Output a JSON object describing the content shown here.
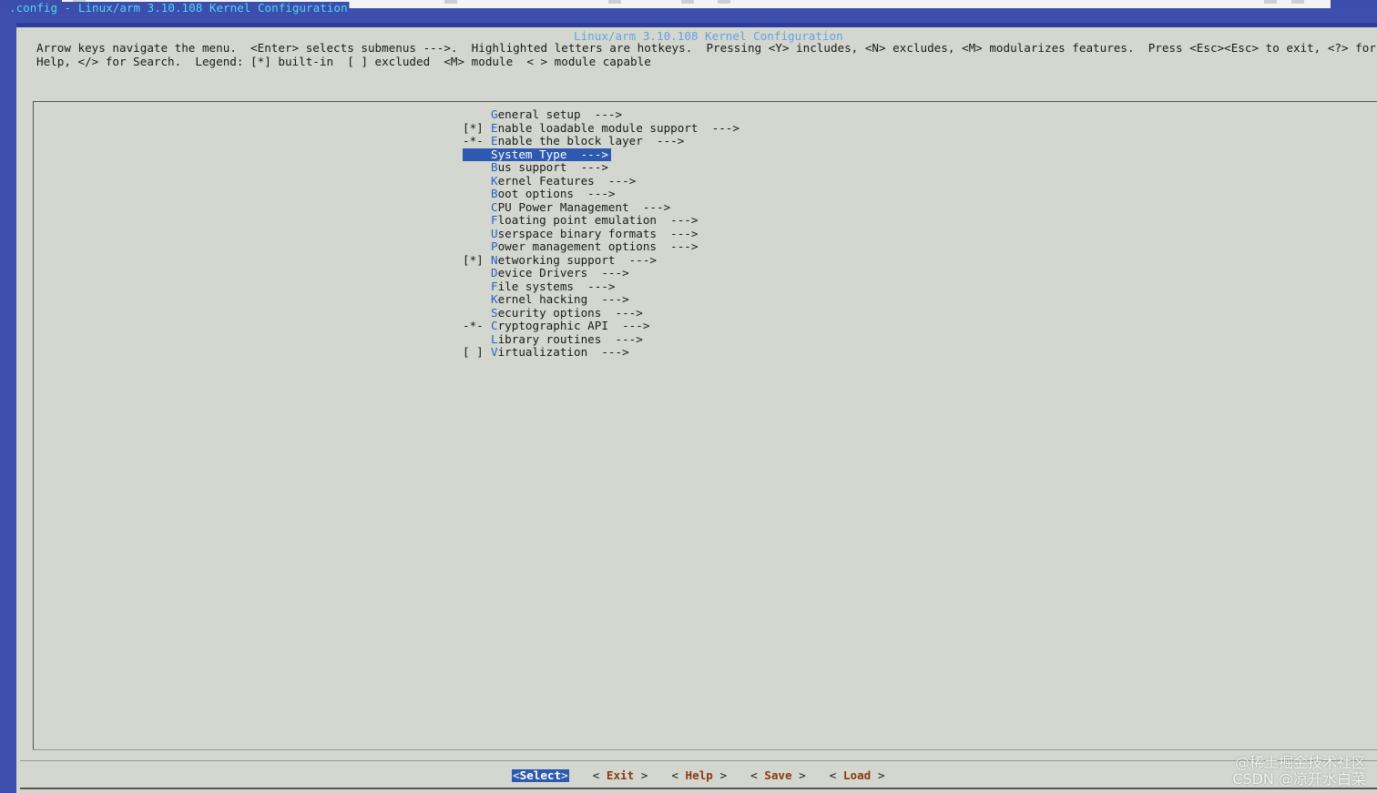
{
  "window": {
    "title": ".config - Linux/arm 3.10.108 Kernel Configuration"
  },
  "dialog": {
    "title": "Linux/arm 3.10.108 Kernel Configuration",
    "help_line1": "Arrow keys navigate the menu.  <Enter> selects submenus --->.  Highlighted letters are hotkeys.  Pressing <Y> includes, <N> excludes, <M> modularizes features.  Press <Esc><Esc> to exit, <?> for",
    "help_line2": "Help, </> for Search.  Legend: [*] built-in  [ ] excluded  <M> module  < > module capable"
  },
  "menu": {
    "selected_index": 3,
    "items": [
      {
        "mark": "   ",
        "hotkey": "G",
        "rest": "eneral setup  --->"
      },
      {
        "mark": "[*]",
        "hotkey": "E",
        "rest": "nable loadable module support  --->"
      },
      {
        "mark": "-*-",
        "hotkey": "E",
        "rest": "nable the block layer  --->"
      },
      {
        "mark": "   ",
        "hotkey": "S",
        "rest": "ystem Type  --->"
      },
      {
        "mark": "   ",
        "hotkey": "B",
        "rest": "us support  --->"
      },
      {
        "mark": "   ",
        "hotkey": "K",
        "rest": "ernel Features  --->"
      },
      {
        "mark": "   ",
        "hotkey": "B",
        "rest": "oot options  --->"
      },
      {
        "mark": "   ",
        "hotkey": "C",
        "rest": "PU Power Management  --->"
      },
      {
        "mark": "   ",
        "hotkey": "F",
        "rest": "loating point emulation  --->"
      },
      {
        "mark": "   ",
        "hotkey": "U",
        "rest": "serspace binary formats  --->"
      },
      {
        "mark": "   ",
        "hotkey": "P",
        "rest": "ower management options  --->"
      },
      {
        "mark": "[*]",
        "hotkey": "N",
        "rest": "etworking support  --->"
      },
      {
        "mark": "   ",
        "hotkey": "D",
        "rest": "evice Drivers  --->"
      },
      {
        "mark": "   ",
        "hotkey": "F",
        "rest": "ile systems  --->"
      },
      {
        "mark": "   ",
        "hotkey": "K",
        "rest": "ernel hacking  --->"
      },
      {
        "mark": "   ",
        "hotkey": "S",
        "rest": "ecurity options  --->"
      },
      {
        "mark": "-*-",
        "hotkey": "C",
        "rest": "ryptographic API  --->"
      },
      {
        "mark": "   ",
        "hotkey": "L",
        "rest": "ibrary routines  --->"
      },
      {
        "mark": "[ ]",
        "hotkey": "V",
        "rest": "irtualization  --->"
      }
    ]
  },
  "buttons": [
    {
      "pre": "<",
      "key": "Select",
      "post": ">",
      "selected": true
    },
    {
      "pre": "< ",
      "key": "Exit",
      "post": " >",
      "selected": false
    },
    {
      "pre": "< ",
      "key": "Help",
      "post": " >",
      "selected": false
    },
    {
      "pre": "< ",
      "key": "Save",
      "post": " >",
      "selected": false
    },
    {
      "pre": "< ",
      "key": "Load",
      "post": " >",
      "selected": false
    }
  ],
  "watermark": {
    "line1": "@稀土掘金技术社区",
    "line2": "CSDN @凉开水白菜"
  },
  "colors": {
    "background": "#d3d7cf",
    "selection": "#2d5ab0",
    "hotkey": "#2d5fc0",
    "title": "#67a1e0",
    "frame": "#3f4fae"
  }
}
